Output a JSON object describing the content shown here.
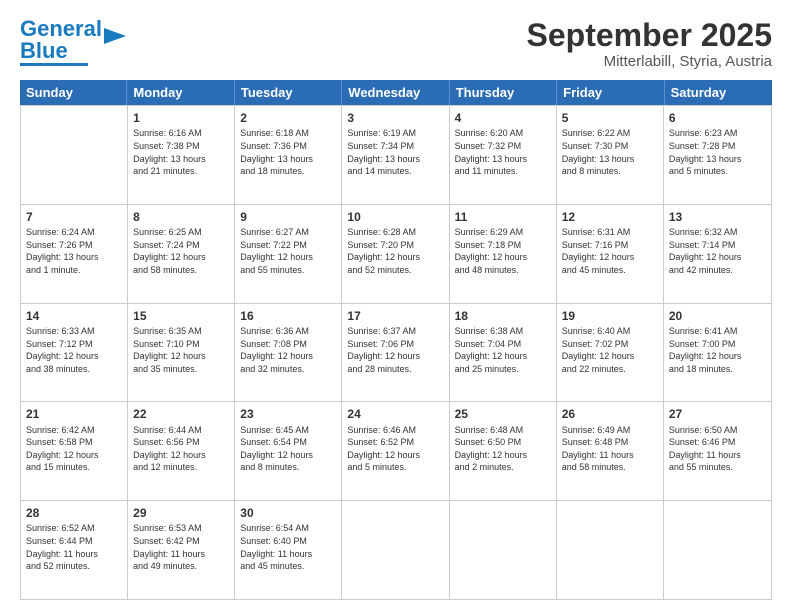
{
  "header": {
    "logo_general": "General",
    "logo_blue": "Blue",
    "month_title": "September 2025",
    "location": "Mitterlabill, Styria, Austria"
  },
  "days_of_week": [
    "Sunday",
    "Monday",
    "Tuesday",
    "Wednesday",
    "Thursday",
    "Friday",
    "Saturday"
  ],
  "rows": [
    [
      {
        "day": "",
        "text": ""
      },
      {
        "day": "1",
        "text": "Sunrise: 6:16 AM\nSunset: 7:38 PM\nDaylight: 13 hours\nand 21 minutes."
      },
      {
        "day": "2",
        "text": "Sunrise: 6:18 AM\nSunset: 7:36 PM\nDaylight: 13 hours\nand 18 minutes."
      },
      {
        "day": "3",
        "text": "Sunrise: 6:19 AM\nSunset: 7:34 PM\nDaylight: 13 hours\nand 14 minutes."
      },
      {
        "day": "4",
        "text": "Sunrise: 6:20 AM\nSunset: 7:32 PM\nDaylight: 13 hours\nand 11 minutes."
      },
      {
        "day": "5",
        "text": "Sunrise: 6:22 AM\nSunset: 7:30 PM\nDaylight: 13 hours\nand 8 minutes."
      },
      {
        "day": "6",
        "text": "Sunrise: 6:23 AM\nSunset: 7:28 PM\nDaylight: 13 hours\nand 5 minutes."
      }
    ],
    [
      {
        "day": "7",
        "text": "Sunrise: 6:24 AM\nSunset: 7:26 PM\nDaylight: 13 hours\nand 1 minute."
      },
      {
        "day": "8",
        "text": "Sunrise: 6:25 AM\nSunset: 7:24 PM\nDaylight: 12 hours\nand 58 minutes."
      },
      {
        "day": "9",
        "text": "Sunrise: 6:27 AM\nSunset: 7:22 PM\nDaylight: 12 hours\nand 55 minutes."
      },
      {
        "day": "10",
        "text": "Sunrise: 6:28 AM\nSunset: 7:20 PM\nDaylight: 12 hours\nand 52 minutes."
      },
      {
        "day": "11",
        "text": "Sunrise: 6:29 AM\nSunset: 7:18 PM\nDaylight: 12 hours\nand 48 minutes."
      },
      {
        "day": "12",
        "text": "Sunrise: 6:31 AM\nSunset: 7:16 PM\nDaylight: 12 hours\nand 45 minutes."
      },
      {
        "day": "13",
        "text": "Sunrise: 6:32 AM\nSunset: 7:14 PM\nDaylight: 12 hours\nand 42 minutes."
      }
    ],
    [
      {
        "day": "14",
        "text": "Sunrise: 6:33 AM\nSunset: 7:12 PM\nDaylight: 12 hours\nand 38 minutes."
      },
      {
        "day": "15",
        "text": "Sunrise: 6:35 AM\nSunset: 7:10 PM\nDaylight: 12 hours\nand 35 minutes."
      },
      {
        "day": "16",
        "text": "Sunrise: 6:36 AM\nSunset: 7:08 PM\nDaylight: 12 hours\nand 32 minutes."
      },
      {
        "day": "17",
        "text": "Sunrise: 6:37 AM\nSunset: 7:06 PM\nDaylight: 12 hours\nand 28 minutes."
      },
      {
        "day": "18",
        "text": "Sunrise: 6:38 AM\nSunset: 7:04 PM\nDaylight: 12 hours\nand 25 minutes."
      },
      {
        "day": "19",
        "text": "Sunrise: 6:40 AM\nSunset: 7:02 PM\nDaylight: 12 hours\nand 22 minutes."
      },
      {
        "day": "20",
        "text": "Sunrise: 6:41 AM\nSunset: 7:00 PM\nDaylight: 12 hours\nand 18 minutes."
      }
    ],
    [
      {
        "day": "21",
        "text": "Sunrise: 6:42 AM\nSunset: 6:58 PM\nDaylight: 12 hours\nand 15 minutes."
      },
      {
        "day": "22",
        "text": "Sunrise: 6:44 AM\nSunset: 6:56 PM\nDaylight: 12 hours\nand 12 minutes."
      },
      {
        "day": "23",
        "text": "Sunrise: 6:45 AM\nSunset: 6:54 PM\nDaylight: 12 hours\nand 8 minutes."
      },
      {
        "day": "24",
        "text": "Sunrise: 6:46 AM\nSunset: 6:52 PM\nDaylight: 12 hours\nand 5 minutes."
      },
      {
        "day": "25",
        "text": "Sunrise: 6:48 AM\nSunset: 6:50 PM\nDaylight: 12 hours\nand 2 minutes."
      },
      {
        "day": "26",
        "text": "Sunrise: 6:49 AM\nSunset: 6:48 PM\nDaylight: 11 hours\nand 58 minutes."
      },
      {
        "day": "27",
        "text": "Sunrise: 6:50 AM\nSunset: 6:46 PM\nDaylight: 11 hours\nand 55 minutes."
      }
    ],
    [
      {
        "day": "28",
        "text": "Sunrise: 6:52 AM\nSunset: 6:44 PM\nDaylight: 11 hours\nand 52 minutes."
      },
      {
        "day": "29",
        "text": "Sunrise: 6:53 AM\nSunset: 6:42 PM\nDaylight: 11 hours\nand 49 minutes."
      },
      {
        "day": "30",
        "text": "Sunrise: 6:54 AM\nSunset: 6:40 PM\nDaylight: 11 hours\nand 45 minutes."
      },
      {
        "day": "",
        "text": ""
      },
      {
        "day": "",
        "text": ""
      },
      {
        "day": "",
        "text": ""
      },
      {
        "day": "",
        "text": ""
      }
    ]
  ]
}
